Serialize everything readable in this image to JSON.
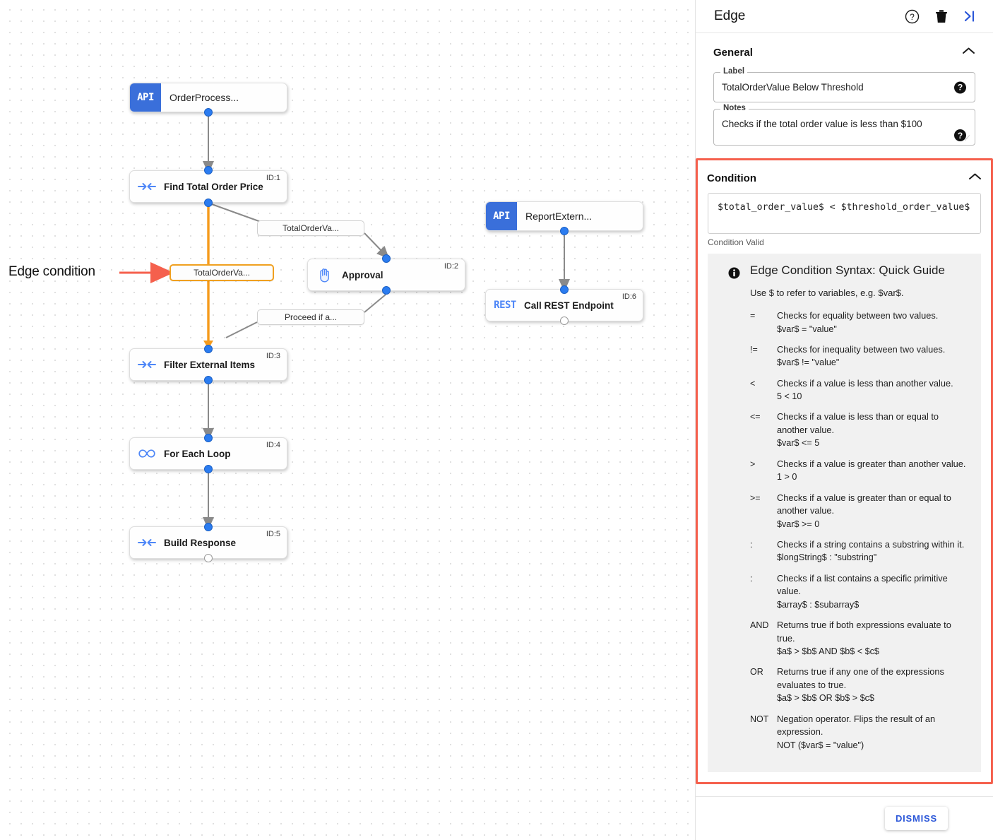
{
  "canvas": {
    "annotation": {
      "text": "Edge condition",
      "arrow_color": "#f5604d"
    },
    "nodes": [
      {
        "id": "n0",
        "badge": "API",
        "title": "OrderProcess...",
        "idlabel": ""
      },
      {
        "id": "n1",
        "icon": "merge-arrows-icon",
        "title": "Find Total Order Price",
        "idlabel": "ID:1"
      },
      {
        "id": "n2",
        "icon": "hand-icon",
        "title": "Approval",
        "idlabel": "ID:2"
      },
      {
        "id": "n3",
        "icon": "merge-arrows-icon",
        "title": "Filter External Items",
        "idlabel": "ID:3"
      },
      {
        "id": "n4",
        "icon": "infinity-icon",
        "title": "For Each Loop",
        "idlabel": "ID:4"
      },
      {
        "id": "n5",
        "icon": "merge-arrows-icon",
        "title": "Build Response",
        "idlabel": "ID:5"
      },
      {
        "id": "n6",
        "badge": "API",
        "title": "ReportExtern...",
        "idlabel": ""
      },
      {
        "id": "n7",
        "badge": "REST",
        "title": "Call REST Endpoint",
        "idlabel": "ID:6"
      }
    ],
    "edge_labels": [
      {
        "id": "el_top",
        "text": "TotalOrderVa...",
        "selected": false
      },
      {
        "id": "el_sel",
        "text": "TotalOrderVa...",
        "selected": true
      },
      {
        "id": "el_proceed",
        "text": "Proceed if a...",
        "selected": false
      }
    ]
  },
  "panel": {
    "title": "Edge",
    "header_icons": [
      {
        "name": "help-icon",
        "glyph": "?"
      },
      {
        "name": "delete-icon",
        "glyph": "trash"
      },
      {
        "name": "collapse-panel-icon",
        "glyph": ">|"
      }
    ],
    "general": {
      "heading": "General",
      "collapse_icon": "chevron-up-icon",
      "label_field": {
        "legend": "Label",
        "value": "TotalOrderValue Below Threshold",
        "help": "?"
      },
      "notes_field": {
        "legend": "Notes",
        "value": "Checks if the total order value is less than $100",
        "help": "?"
      }
    },
    "condition": {
      "heading": "Condition",
      "collapse_icon": "chevron-up-icon",
      "expression": "$total_order_value$ < $threshold_order_value$",
      "status": "Condition Valid",
      "highlight_color": "#f5604d",
      "guide": {
        "icon": "info-icon",
        "title": "Edge Condition Syntax: Quick Guide",
        "subtitle": "Use $ to refer to variables, e.g. $var$.",
        "rows": [
          {
            "op": "=",
            "desc": "Checks for equality between two values.",
            "example": "$var$ = \"value\""
          },
          {
            "op": "!=",
            "desc": "Checks for inequality between two values.",
            "example": "$var$ != \"value\""
          },
          {
            "op": "<",
            "desc": "Checks if a value is less than another value.",
            "example": "5 < 10"
          },
          {
            "op": "<=",
            "desc": "Checks if a value is less than or equal to another value.",
            "example": "$var$ <= 5"
          },
          {
            "op": ">",
            "desc": "Checks if a value is greater than another value.",
            "example": "1 > 0"
          },
          {
            "op": ">=",
            "desc": "Checks if a value is greater than or equal to another value.",
            "example": "$var$ >= 0"
          },
          {
            "op": ":",
            "desc": "Checks if a string contains a substring within it.",
            "example": "$longString$ : \"substring\""
          },
          {
            "op": ":",
            "desc": "Checks if a list contains a specific primitive value.",
            "example": "$array$ : $subarray$"
          },
          {
            "op": "AND",
            "desc": "Returns true if both expressions evaluate to true.",
            "example": "$a$ > $b$ AND $b$ < $c$"
          },
          {
            "op": "OR",
            "desc": "Returns true if any one of the expressions evaluates to true.",
            "example": "$a$ > $b$ OR $b$ > $c$"
          },
          {
            "op": "NOT",
            "desc": "Negation operator. Flips the result of an expression.",
            "example": "NOT ($var$ = \"value\")"
          }
        ]
      }
    },
    "footer": {
      "dismiss_label": "DISMISS"
    }
  }
}
